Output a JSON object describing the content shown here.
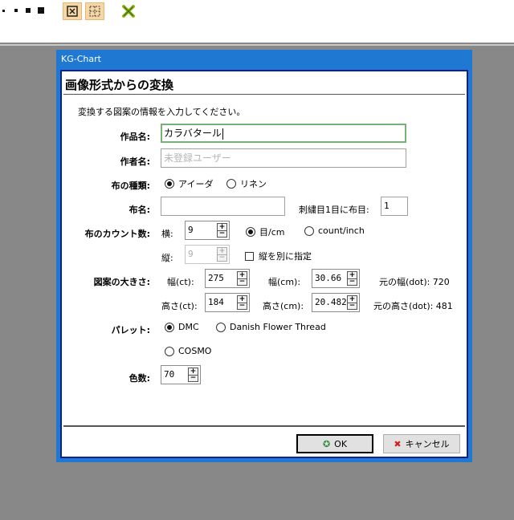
{
  "window": {
    "title": "KG-Chart"
  },
  "dialog": {
    "heading": "画像形式からの変換",
    "description": "変換する図案の情報を入力してください。"
  },
  "fields": {
    "work_name_label": "作品名:",
    "work_name_value": "カラバタール",
    "author_label": "作者名:",
    "author_placeholder": "未登録ユーザー",
    "cloth_type_label": "布の種類:",
    "cloth_type_options": [
      "アイーダ",
      "リネン"
    ],
    "cloth_name_label": "布名:",
    "cloth_name_value": "",
    "start_label": "刺繍目1目に布目:",
    "start_value": "1",
    "count_label": "布のカウント数:",
    "horiz_label": "横:",
    "horiz_value": "9",
    "unit_options": [
      "目/cm",
      "count/inch"
    ],
    "vert_label": "縦:",
    "vert_value": "9",
    "vert_separate_label": "縦を別に指定",
    "size_label": "図案の大きさ:",
    "width_ct_label": "幅(ct):",
    "width_ct_value": "275",
    "width_cm_label": "幅(cm):",
    "width_cm_value": "30.66",
    "orig_width_label": "元の幅(dot): 720",
    "height_ct_label": "高さ(ct):",
    "height_ct_value": "184",
    "height_cm_label": "高さ(cm):",
    "height_cm_value": "20.482",
    "orig_height_label": "元の高さ(dot): 481",
    "palette_label": "パレット:",
    "palette_options": [
      "DMC",
      "Danish Flower Thread",
      "COSMO"
    ],
    "colors_label": "色数:",
    "colors_value": "70"
  },
  "buttons": {
    "ok_label": "OK",
    "cancel_label": "キャンセル"
  },
  "icons": {
    "ok": "check-circle-icon",
    "cancel": "x-mark-icon",
    "toolbar": [
      "dot-small-icon",
      "dot-medium-icon",
      "dot-large-icon",
      "dot-xlarge-icon",
      "grid-box-icon",
      "grid-dotted-icon",
      "cross-stitch-x-icon"
    ]
  },
  "colors": {
    "window_accent": "#1f79d2",
    "client_border": "#0a1f8f",
    "toolbar_btn": "#f6d7a5",
    "ok_icon": "#2e8b3a",
    "cancel_icon": "#d11f1f",
    "cross_icon": "#8bb81a"
  }
}
